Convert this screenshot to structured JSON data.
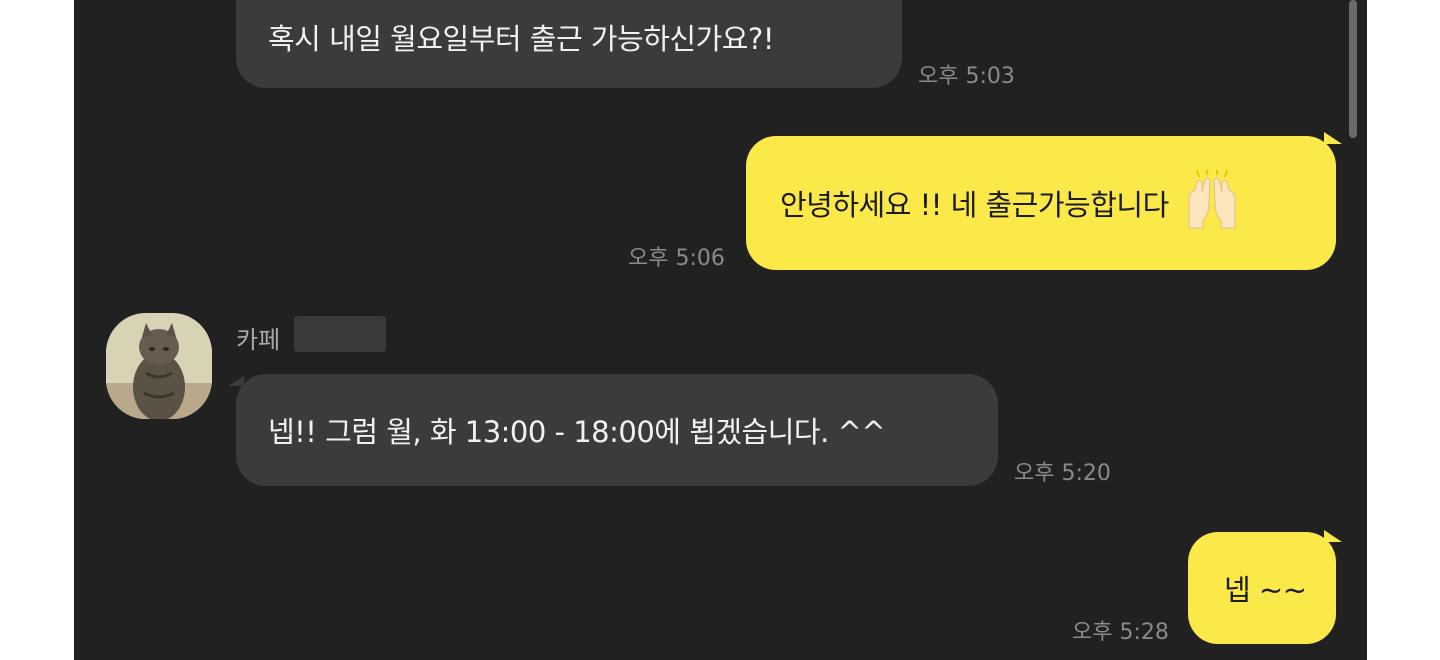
{
  "messages": [
    {
      "direction": "incoming",
      "text": "혹시 내일 월요일부터 출근 가능하신가요?!",
      "time": "오후 5:03"
    },
    {
      "direction": "outgoing",
      "text": "안녕하세요 !! 네 출근가능합니다",
      "emoji": "raising-hands-icon",
      "time": "오후 5:06"
    },
    {
      "direction": "incoming",
      "sender": "카페",
      "text": "넵!! 그럼 월, 화 13:00 - 18:00에 뵙겠습니다. ^^",
      "time": "오후 5:20"
    },
    {
      "direction": "outgoing",
      "text": "넵 ~~",
      "time": "오후 5:28"
    }
  ],
  "colors": {
    "background": "#212121",
    "incoming_bubble": "#3b3b3b",
    "outgoing_bubble": "#fbe94a",
    "timestamp": "#8a8a8a"
  }
}
